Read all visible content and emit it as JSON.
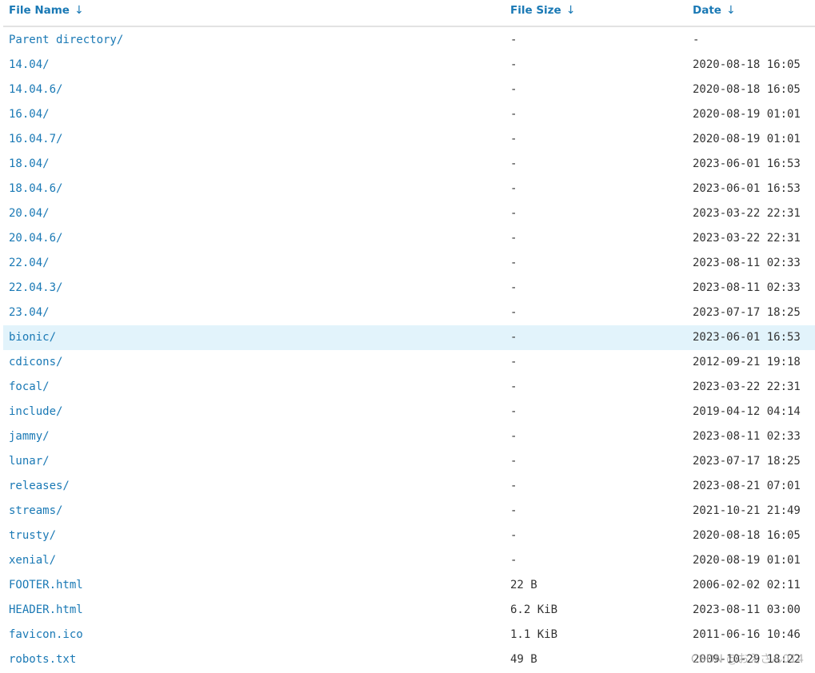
{
  "header": {
    "name_label": "File Name",
    "size_label": "File Size",
    "date_label": "Date",
    "sort_arrow": "↓"
  },
  "rows": [
    {
      "name": "Parent directory/",
      "size": "-",
      "date": "-"
    },
    {
      "name": "14.04/",
      "size": "-",
      "date": "2020-08-18 16:05"
    },
    {
      "name": "14.04.6/",
      "size": "-",
      "date": "2020-08-18 16:05"
    },
    {
      "name": "16.04/",
      "size": "-",
      "date": "2020-08-19 01:01"
    },
    {
      "name": "16.04.7/",
      "size": "-",
      "date": "2020-08-19 01:01"
    },
    {
      "name": "18.04/",
      "size": "-",
      "date": "2023-06-01 16:53"
    },
    {
      "name": "18.04.6/",
      "size": "-",
      "date": "2023-06-01 16:53"
    },
    {
      "name": "20.04/",
      "size": "-",
      "date": "2023-03-22 22:31"
    },
    {
      "name": "20.04.6/",
      "size": "-",
      "date": "2023-03-22 22:31"
    },
    {
      "name": "22.04/",
      "size": "-",
      "date": "2023-08-11 02:33"
    },
    {
      "name": "22.04.3/",
      "size": "-",
      "date": "2023-08-11 02:33"
    },
    {
      "name": "23.04/",
      "size": "-",
      "date": "2023-07-17 18:25"
    },
    {
      "name": "bionic/",
      "size": "-",
      "date": "2023-06-01 16:53"
    },
    {
      "name": "cdicons/",
      "size": "-",
      "date": "2012-09-21 19:18"
    },
    {
      "name": "focal/",
      "size": "-",
      "date": "2023-03-22 22:31"
    },
    {
      "name": "include/",
      "size": "-",
      "date": "2019-04-12 04:14"
    },
    {
      "name": "jammy/",
      "size": "-",
      "date": "2023-08-11 02:33"
    },
    {
      "name": "lunar/",
      "size": "-",
      "date": "2023-07-17 18:25"
    },
    {
      "name": "releases/",
      "size": "-",
      "date": "2023-08-21 07:01"
    },
    {
      "name": "streams/",
      "size": "-",
      "date": "2021-10-21 21:49"
    },
    {
      "name": "trusty/",
      "size": "-",
      "date": "2020-08-18 16:05"
    },
    {
      "name": "xenial/",
      "size": "-",
      "date": "2020-08-19 01:01"
    },
    {
      "name": "FOOTER.html",
      "size": "22 B",
      "date": "2006-02-02 02:11"
    },
    {
      "name": "HEADER.html",
      "size": "6.2 KiB",
      "date": "2023-08-11 03:00"
    },
    {
      "name": "favicon.ico",
      "size": "1.1 KiB",
      "date": "2011-06-16 10:46"
    },
    {
      "name": "robots.txt",
      "size": "49 B",
      "date": "2009-10-29 18:22"
    }
  ],
  "highlighted_row": "bionic/",
  "watermark": "CSDN @おえさん014",
  "colors": {
    "link": "#1a79b5",
    "text": "#333333",
    "highlight": "#e2f3fb",
    "header_rule": "#e3e3e3"
  }
}
